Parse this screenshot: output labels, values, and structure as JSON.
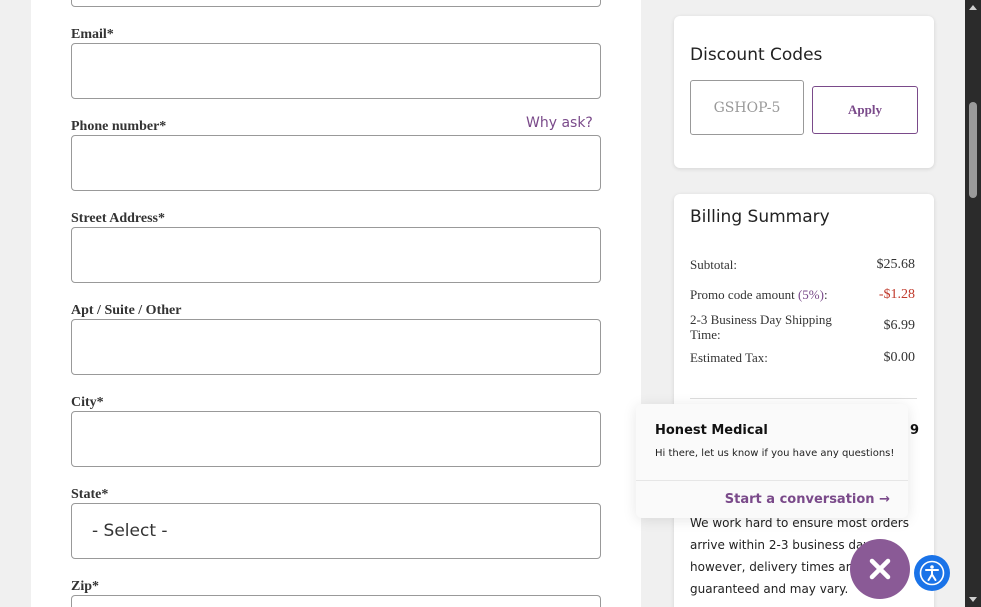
{
  "form": {
    "email_label": "Email*",
    "phone_label": "Phone number*",
    "why_ask": "Why ask?",
    "street_label": "Street Address*",
    "apt_label": "Apt / Suite / Other",
    "city_label": "City*",
    "state_label": "State*",
    "state_value": "- Select -",
    "zip_label": "Zip*"
  },
  "discount": {
    "title": "Discount Codes",
    "code_placeholder": "GSHOP-5",
    "apply_label": "Apply"
  },
  "billing": {
    "title": "Billing Summary",
    "subtotal_label": "Subtotal:",
    "subtotal_value": "$25.68",
    "promo_label": "Promo code amount",
    "promo_pct": "(5%)",
    "promo_colon": ":",
    "promo_value": "-$1.28",
    "shipping_label": "2-3 Business Day Shipping Time:",
    "shipping_value": "$6.99",
    "tax_label": "Estimated Tax:",
    "tax_value": "$0.00",
    "shipping_note": "We work hard to ensure most orders arrive within 2-3 business days; however, delivery times are not guaranteed and may vary."
  },
  "chat": {
    "name": "Honest Medical",
    "count": "9",
    "message": "Hi there, let us know if you have any questions!",
    "cta": "Start a conversation",
    "cta_arrow": "→"
  },
  "colors": {
    "accent": "#7a4a8a",
    "fab": "#8a5a96",
    "negative": "#c0392b",
    "a11y": "#1a73e8"
  },
  "icons": {
    "close": "close-icon",
    "accessibility": "accessibility-icon",
    "arrow": "arrow-right-icon"
  }
}
